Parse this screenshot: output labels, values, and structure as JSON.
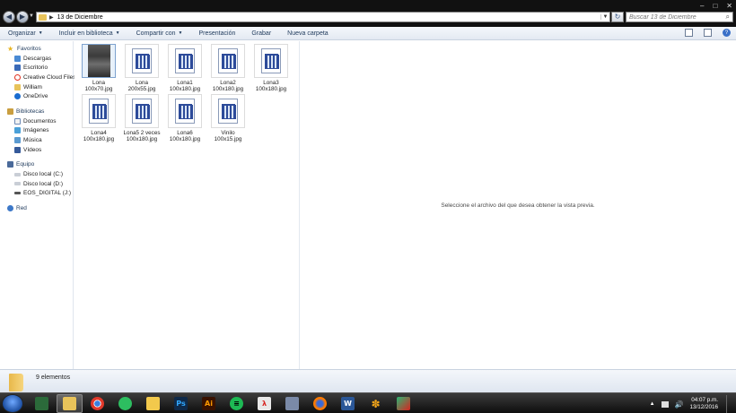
{
  "address": {
    "crumb": "13 de Diciembre"
  },
  "search": {
    "placeholder": "Buscar 13 de Diciembre"
  },
  "toolbar": {
    "organize": "Organizar",
    "include": "Incluir en biblioteca",
    "share": "Compartir con",
    "slideshow": "Presentación",
    "burn": "Grabar",
    "new_folder": "Nueva carpeta"
  },
  "nav": {
    "favorites": "Favoritos",
    "downloads": "Descargas",
    "desktop": "Escritorio",
    "cc_files": "Creative Cloud Files",
    "william": "William",
    "onedrive": "OneDrive",
    "libraries": "Bibliotecas",
    "documents": "Documentos",
    "images": "Imágenes",
    "music": "Música",
    "videos": "Vídeos",
    "computer": "Equipo",
    "disk_c": "Disco local (C:)",
    "disk_d": "Disco local (D:)",
    "eos": "EOS_DIGITAL (J:)",
    "network": "Red"
  },
  "files": [
    {
      "name": "Lona 100x70.jpg"
    },
    {
      "name": "Lona 200x55.jpg"
    },
    {
      "name": "Lona1 100x180.jpg"
    },
    {
      "name": "Lona2 100x180.jpg"
    },
    {
      "name": "Lona3 100x180.jpg"
    },
    {
      "name": "Lona4 100x180.jpg"
    },
    {
      "name": "Lona5 2 veces 100x180.jpg"
    },
    {
      "name": "Lona6 100x180.jpg"
    },
    {
      "name": "Vinilo 100x15.jpg"
    }
  ],
  "preview": {
    "message": "Seleccione el archivo del que desea obtener la vista previa."
  },
  "details": {
    "count": "9 elementos"
  },
  "taskbar": {
    "apps": [
      "desktop",
      "explorer",
      "chrome",
      "evernote",
      "photos",
      "photoshop",
      "illustrator",
      "spotify",
      "acrobat",
      "app",
      "firefox",
      "word",
      "tools",
      "app2"
    ],
    "time": "04:07 p.m.",
    "date": "13/12/2016"
  }
}
